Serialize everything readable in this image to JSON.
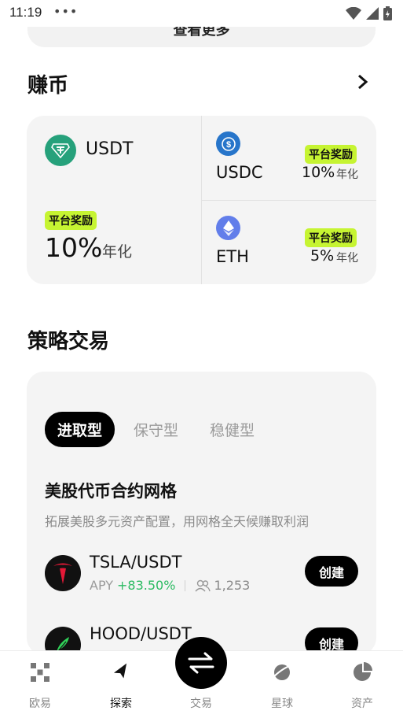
{
  "status_bar": {
    "time": "11:19",
    "dots": "•••"
  },
  "top_card": {
    "label": "查看更多"
  },
  "earn": {
    "title": "赚币",
    "featured": {
      "symbol": "USDT",
      "badge": "平台奖励",
      "rate": "10%",
      "rate_suffix": "年化"
    },
    "coins": [
      {
        "symbol": "USDC",
        "badge": "平台奖励",
        "rate": "10%",
        "rate_suffix": "年化"
      },
      {
        "symbol": "ETH",
        "badge": "平台奖励",
        "rate": "5%",
        "rate_suffix": "年化"
      }
    ]
  },
  "strategy": {
    "title": "策略交易",
    "tabs": [
      {
        "label": "进取型"
      },
      {
        "label": "保守型"
      },
      {
        "label": "稳健型"
      }
    ],
    "name": "美股代币合约网格",
    "description": "拓展美股多元资产配置，用网格全天候赚取利润",
    "pairs": [
      {
        "name": "TSLA/USDT",
        "apy_label": "APY",
        "apy_value": "+83.50%",
        "users": "1,253",
        "button": "创建"
      },
      {
        "name": "HOOD/USDT",
        "button": "创建"
      }
    ]
  },
  "bottom_nav": {
    "items": [
      {
        "label": "欧易"
      },
      {
        "label": "探索"
      },
      {
        "label": "交易"
      },
      {
        "label": "星球"
      },
      {
        "label": "资产"
      }
    ]
  },
  "colors": {
    "badge": "#c6f432",
    "positive": "#2dbb63",
    "usdt": "#26a17b",
    "usdc": "#2775ca",
    "eth": "#627eea"
  }
}
